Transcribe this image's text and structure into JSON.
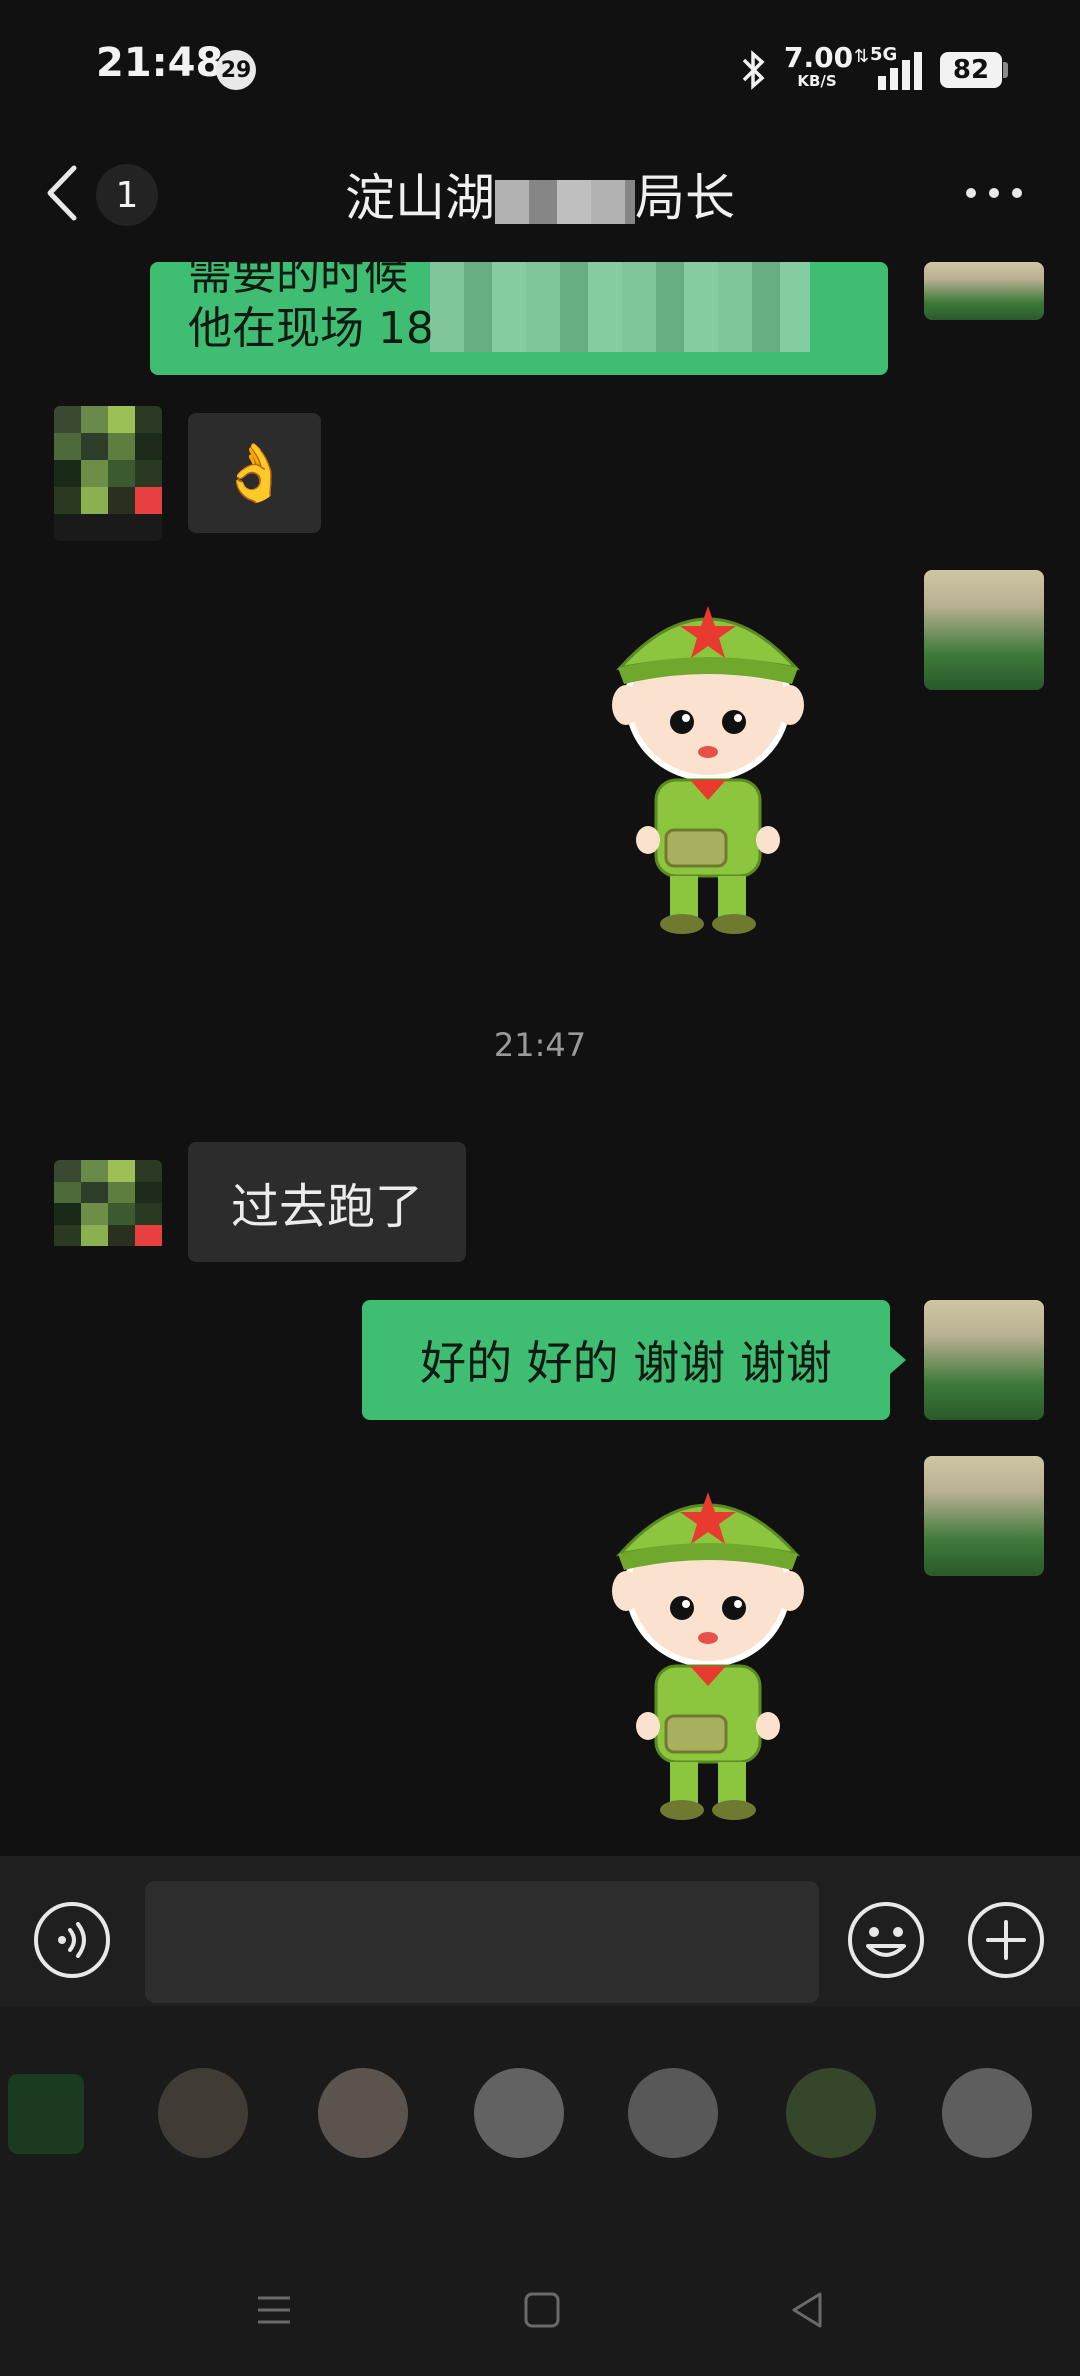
{
  "status_bar": {
    "time": "21:48",
    "notification_count": "29",
    "net_speed_value": "7.00",
    "net_speed_unit": "KB/S",
    "network_type": "5G",
    "battery": "82"
  },
  "header": {
    "back_badge": "1",
    "title_prefix": "淀山湖",
    "title_suffix": "局长"
  },
  "messages": [
    {
      "from": "me",
      "type": "text",
      "lines": [
        "需要的时候",
        "他在现场 18"
      ]
    },
    {
      "from": "other",
      "type": "emoji",
      "text": "👌"
    },
    {
      "from": "me",
      "type": "sticker",
      "sticker": "soldier-cartoon"
    },
    {
      "type": "time",
      "text": "21:47"
    },
    {
      "from": "other",
      "type": "text",
      "text": "过去跑了"
    },
    {
      "from": "me",
      "type": "text",
      "text": "好的 好的 谢谢 谢谢"
    },
    {
      "from": "me",
      "type": "sticker",
      "sticker": "soldier-cartoon"
    }
  ],
  "input": {
    "value": "",
    "placeholder": ""
  },
  "colors": {
    "bubble_me": "#3fbd73",
    "bubble_other": "#2c2c2c",
    "background": "#111111"
  }
}
